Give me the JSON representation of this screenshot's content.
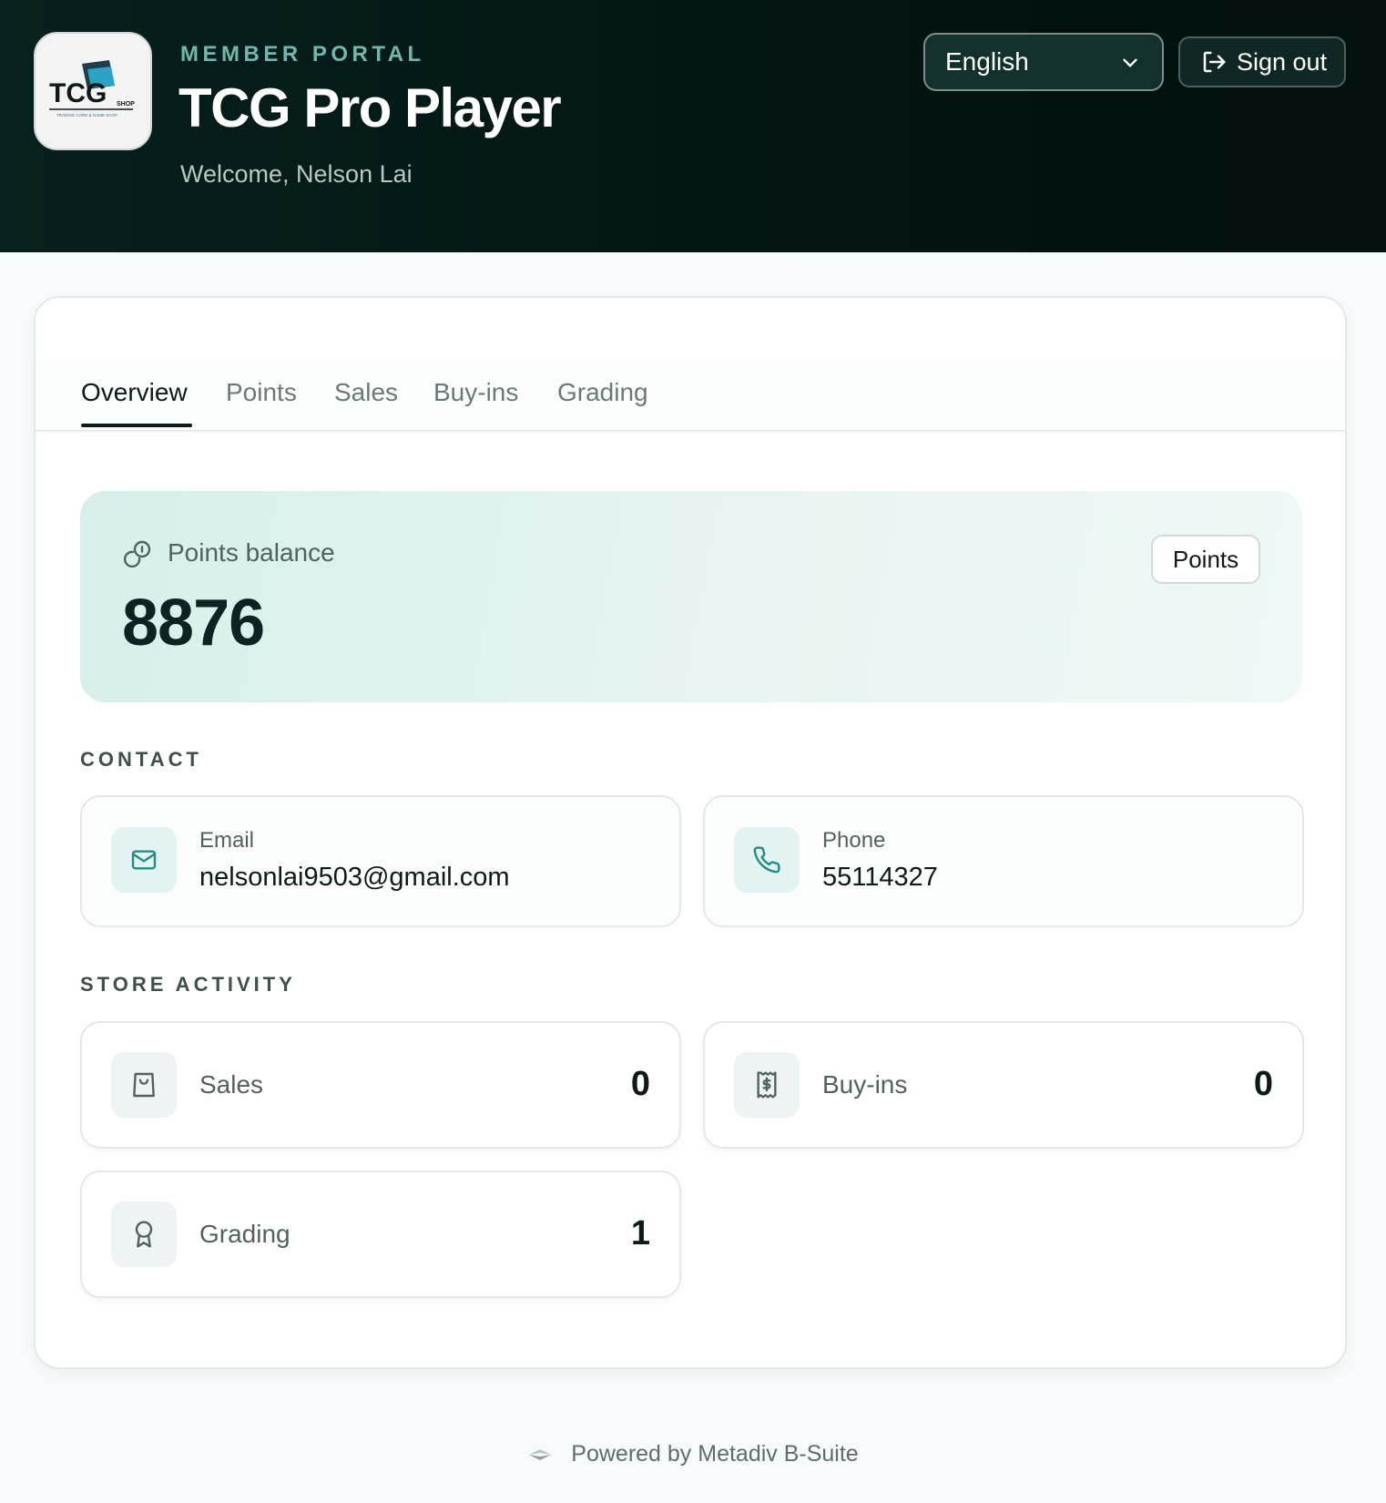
{
  "header": {
    "eyebrow": "MEMBER PORTAL",
    "title": "TCG Pro Player",
    "welcome": "Welcome, Nelson Lai",
    "logo_text": "TCG",
    "logo_subtext": "SHOP",
    "logo_tagline": "TRADING CARD & GAME SHOP",
    "language": "English",
    "signout_label": "Sign out"
  },
  "tabs": [
    {
      "label": "Overview",
      "active": true
    },
    {
      "label": "Points",
      "active": false
    },
    {
      "label": "Sales",
      "active": false
    },
    {
      "label": "Buy-ins",
      "active": false
    },
    {
      "label": "Grading",
      "active": false
    }
  ],
  "balance": {
    "label": "Points balance",
    "value": "8876",
    "button_label": "Points",
    "icon": "coins-icon"
  },
  "contact": {
    "title": "CONTACT",
    "email": {
      "label": "Email",
      "value": "nelsonlai9503@gmail.com",
      "icon": "mail-icon"
    },
    "phone": {
      "label": "Phone",
      "value": "55114327",
      "icon": "phone-icon"
    }
  },
  "activity": {
    "title": "STORE ACTIVITY",
    "sales": {
      "label": "Sales",
      "value": "0",
      "icon": "shopping-bag-icon"
    },
    "buyins": {
      "label": "Buy-ins",
      "value": "0",
      "icon": "receipt-icon"
    },
    "grading": {
      "label": "Grading",
      "value": "1",
      "icon": "award-icon"
    }
  },
  "footer": {
    "text": "Powered by Metadiv B-Suite"
  },
  "colors": {
    "header_bg": "#031412",
    "accent": "#1f8f84",
    "eyebrow": "#6fb8ae",
    "balance_bg": "#d6efeb"
  }
}
